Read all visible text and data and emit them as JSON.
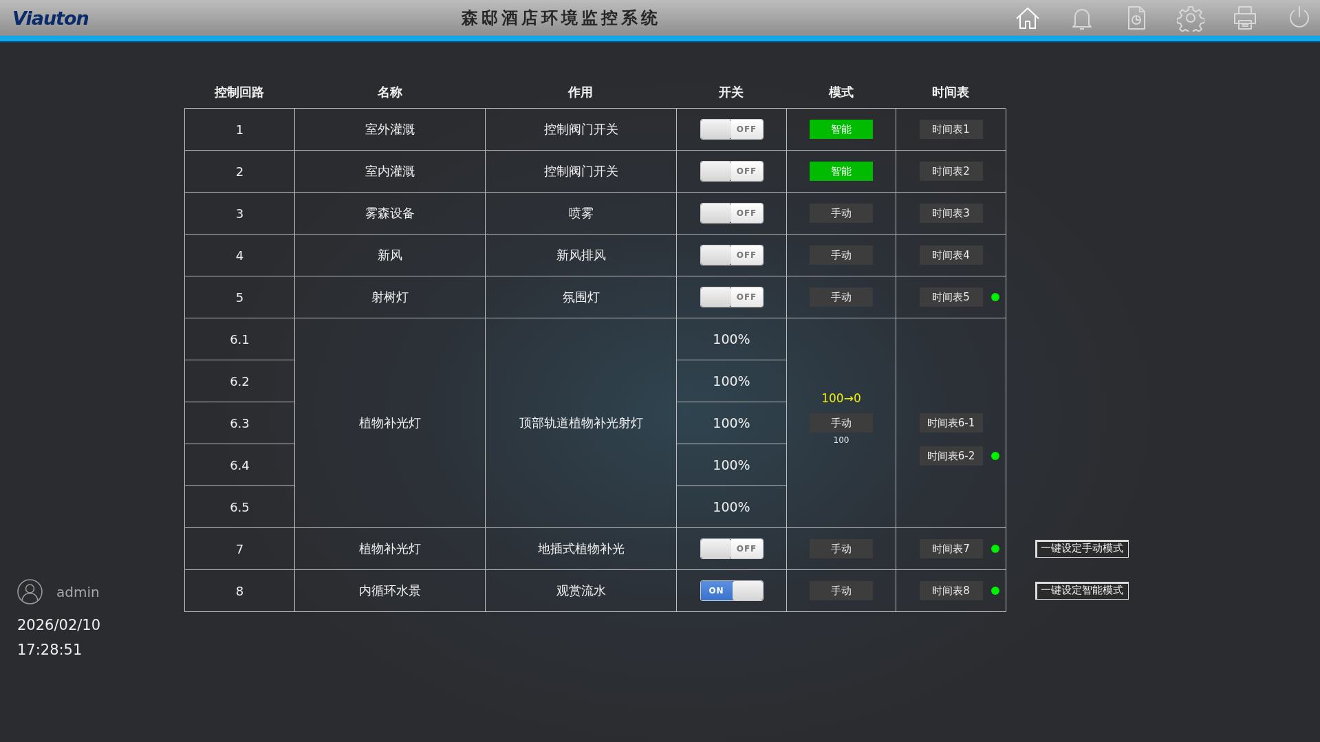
{
  "header": {
    "logo": "Viauton",
    "title": "森邸酒店环境监控系统"
  },
  "user": {
    "name": "admin",
    "date": "2026/02/10",
    "time": "17:28:51"
  },
  "table": {
    "columns": [
      "控制回路",
      "名称",
      "作用",
      "开关",
      "模式",
      "时间表"
    ],
    "rows": [
      {
        "kind": "single",
        "circuit": "1",
        "name": "室外灌溉",
        "function": "控制阀门开关",
        "switch": {
          "on": false,
          "label": "OFF"
        },
        "mode": {
          "label": "智能",
          "smart": true
        },
        "schedule": {
          "label": "时间表1",
          "active": false
        }
      },
      {
        "kind": "single",
        "circuit": "2",
        "name": "室内灌溉",
        "function": "控制阀门开关",
        "switch": {
          "on": false,
          "label": "OFF"
        },
        "mode": {
          "label": "智能",
          "smart": true
        },
        "schedule": {
          "label": "时间表2",
          "active": false
        }
      },
      {
        "kind": "single",
        "circuit": "3",
        "name": "雾森设备",
        "function": "喷雾",
        "switch": {
          "on": false,
          "label": "OFF"
        },
        "mode": {
          "label": "手动",
          "smart": false
        },
        "schedule": {
          "label": "时间表3",
          "active": false
        }
      },
      {
        "kind": "single",
        "circuit": "4",
        "name": "新风",
        "function": "新风排风",
        "switch": {
          "on": false,
          "label": "OFF"
        },
        "mode": {
          "label": "手动",
          "smart": false
        },
        "schedule": {
          "label": "时间表4",
          "active": false
        }
      },
      {
        "kind": "single",
        "circuit": "5",
        "name": "射树灯",
        "function": "氛围灯",
        "switch": {
          "on": false,
          "label": "OFF"
        },
        "mode": {
          "label": "手动",
          "smart": false
        },
        "schedule": {
          "label": "时间表5",
          "active": true
        }
      },
      {
        "kind": "group",
        "circuits": [
          {
            "circuit": "6.1",
            "value": "100%"
          },
          {
            "circuit": "6.2",
            "value": "100%"
          },
          {
            "circuit": "6.3",
            "value": "100%"
          },
          {
            "circuit": "6.4",
            "value": "100%"
          },
          {
            "circuit": "6.5",
            "value": "100%"
          }
        ],
        "name": "植物补光灯",
        "function": "顶部轨道植物补光射灯",
        "mode": {
          "label": "手动",
          "smart": false,
          "fade": "100→0",
          "value": "100"
        },
        "schedules": [
          {
            "label": "时间表6-1",
            "active": false
          },
          {
            "label": "时间表6-2",
            "active": true
          }
        ]
      },
      {
        "kind": "single",
        "circuit": "7",
        "name": "植物补光灯",
        "function": "地插式植物补光",
        "switch": {
          "on": false,
          "label": "OFF"
        },
        "mode": {
          "label": "手动",
          "smart": false
        },
        "schedule": {
          "label": "时间表7",
          "active": true
        }
      },
      {
        "kind": "single",
        "circuit": "8",
        "name": "内循环水景",
        "function": "观赏流水",
        "switch": {
          "on": true,
          "label": "ON"
        },
        "mode": {
          "label": "手动",
          "smart": false
        },
        "schedule": {
          "label": "时间表8",
          "active": true
        }
      }
    ]
  },
  "actions": [
    "一键设定手动模式",
    "一键设定智能模式"
  ]
}
